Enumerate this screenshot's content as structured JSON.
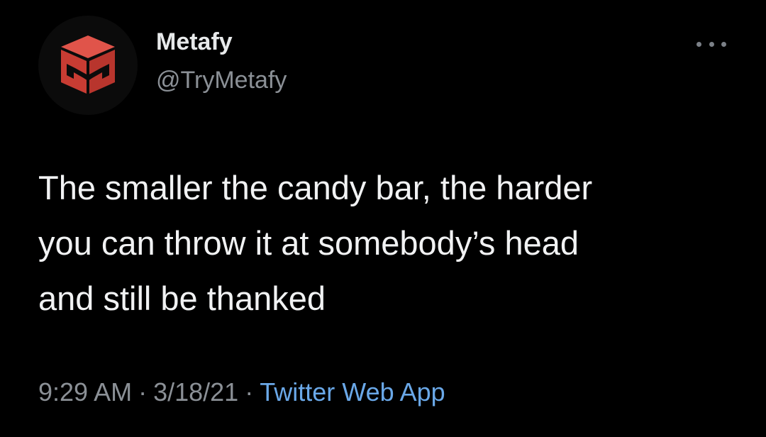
{
  "tweet": {
    "author": {
      "display_name": "Metafy",
      "handle": "@TryMetafy",
      "avatar_icon": "metafy-logo-icon",
      "brand_color": "#d9463c"
    },
    "more_icon": "more-dots-icon",
    "text_lines": [
      "The smaller the candy bar, the harder",
      "you can throw it at somebody’s head",
      "and still be thanked"
    ],
    "meta": {
      "time": "9:29 AM",
      "separator": "·",
      "date": "3/18/21",
      "source": "Twitter Web App",
      "source_color": "#6aa8e8"
    }
  }
}
